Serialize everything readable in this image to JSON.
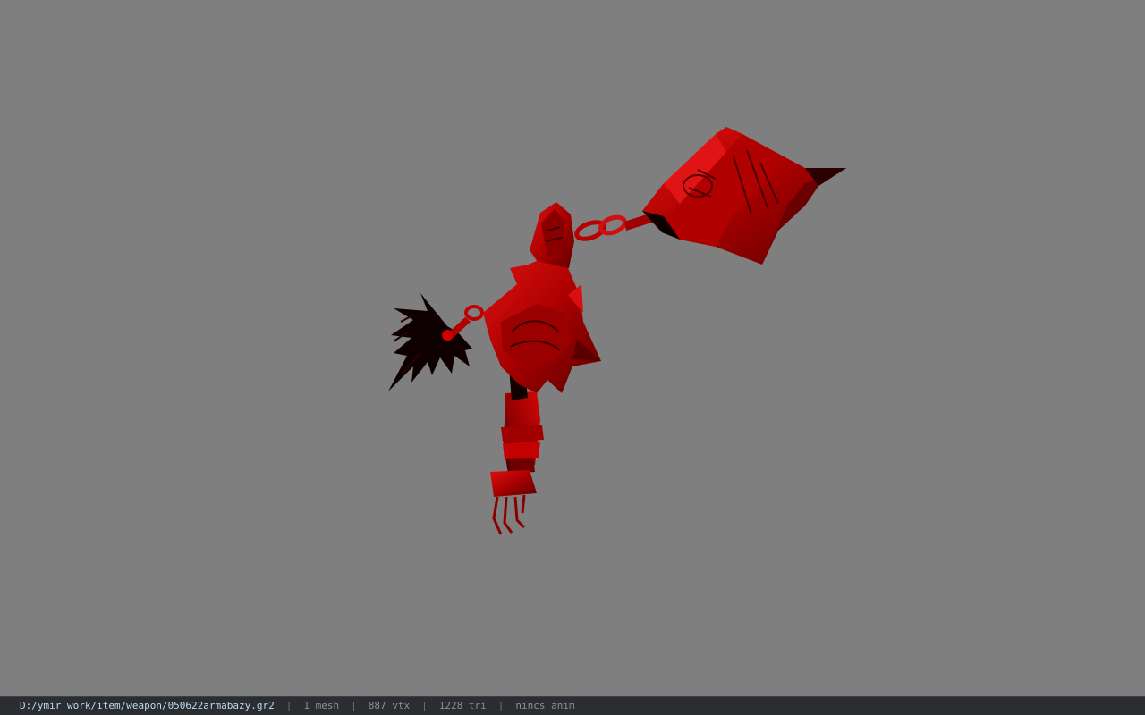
{
  "viewer": {
    "background_color": "#7f7f7f",
    "model_primary_color": "#c40000",
    "model_shadow_color": "#1a0000"
  },
  "statusbar": {
    "file_path": "D:/ymir work/item/weapon/050622armabazy.gr2",
    "separator": "|",
    "mesh_count": "1 mesh",
    "vertex_count": "887 vtx",
    "triangle_count": "1228 tri",
    "animation_status": "nincs anim"
  }
}
